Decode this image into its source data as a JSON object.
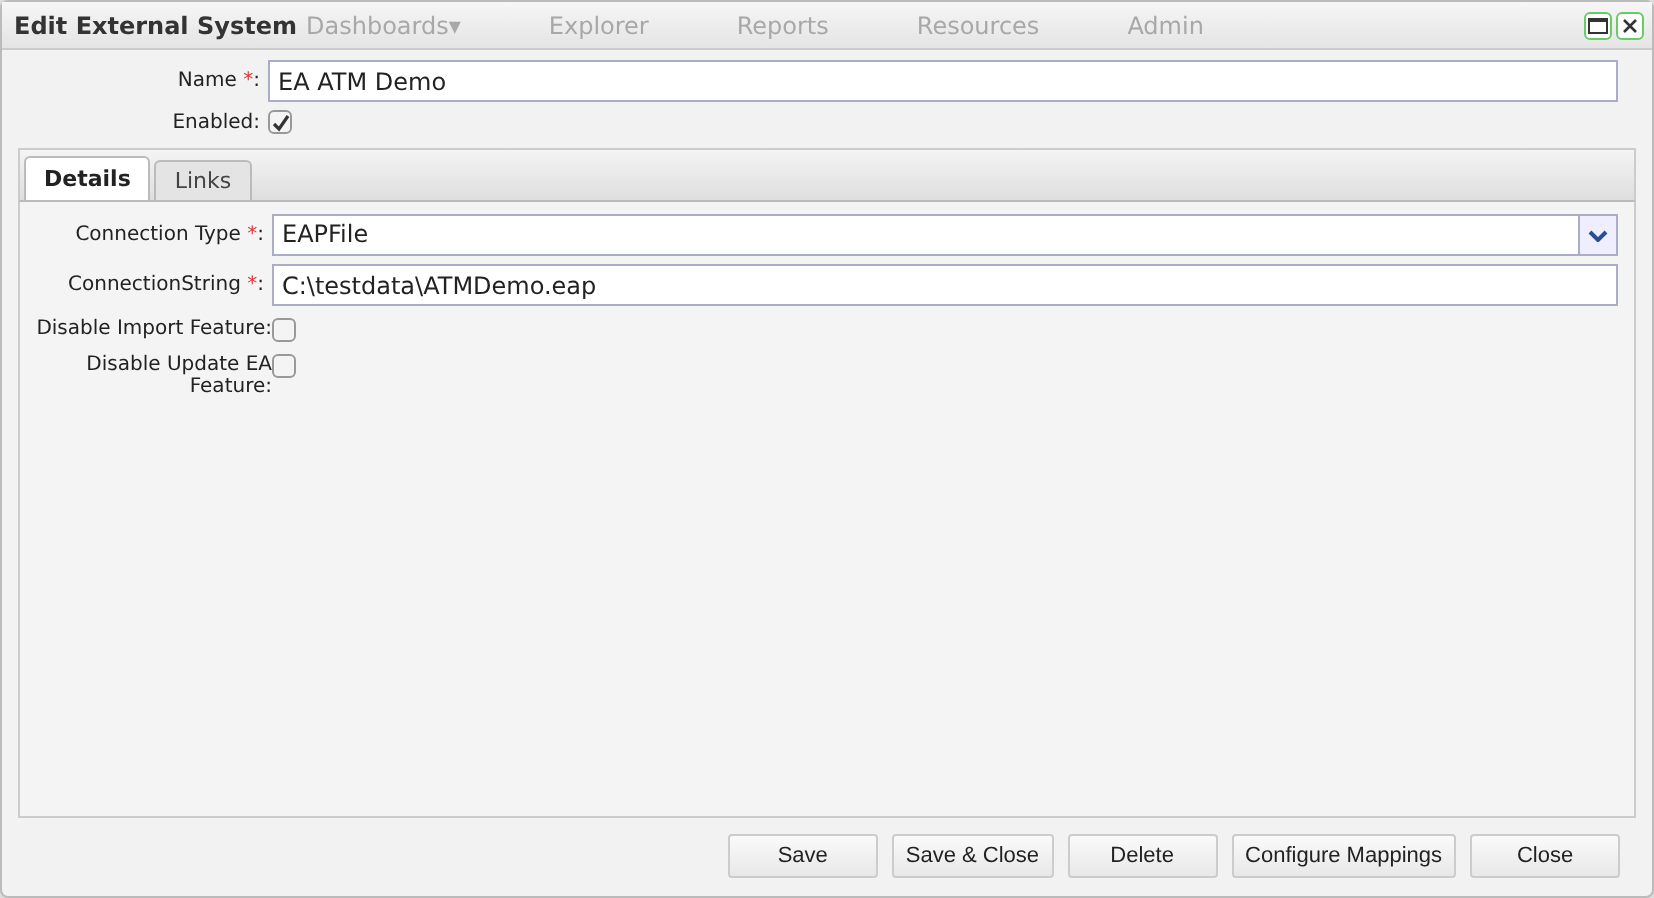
{
  "window": {
    "title": "Edit External System"
  },
  "background_nav": [
    "Dashboards▾",
    "Explorer",
    "Reports",
    "Resources",
    "Admin"
  ],
  "form": {
    "name": {
      "label": "Name",
      "required_mark": "*:",
      "value": "EA ATM Demo"
    },
    "enabled": {
      "label": "Enabled:",
      "checked": true
    }
  },
  "tabs": [
    {
      "label": "Details",
      "selected": true
    },
    {
      "label": "Links",
      "selected": false
    }
  ],
  "details": [
    {
      "kind": "select",
      "label": "Connection Type",
      "required_mark": "*:",
      "value": "EAPFile"
    },
    {
      "kind": "text",
      "label": "ConnectionString",
      "required_mark": "*:",
      "value": "C:\\testdata\\ATMDemo.eap"
    },
    {
      "kind": "checkbox",
      "label": "Disable Import Feature:",
      "checked": false
    },
    {
      "kind": "checkbox",
      "label": "Disable Update EA Feature:",
      "checked": false
    }
  ],
  "buttons": [
    "Save",
    "Save & Close",
    "Delete",
    "Configure Mappings",
    "Close"
  ]
}
